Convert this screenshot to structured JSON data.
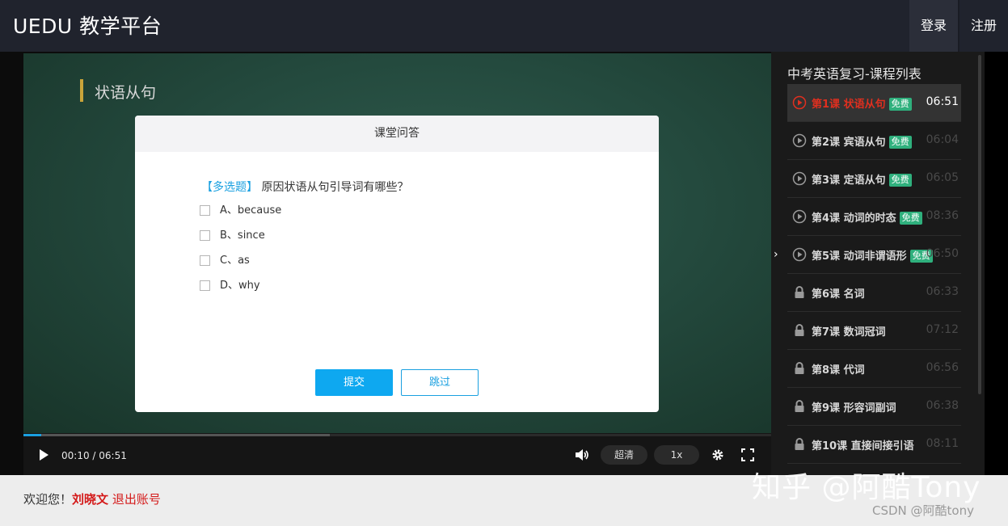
{
  "header": {
    "brand": "UEDU 教学平台",
    "login": "登录",
    "register": "注册"
  },
  "video": {
    "board_title": "状语从句",
    "current_time": "00:10 / 06:51",
    "quality": "超清",
    "speed": "1x",
    "progress_fraction": 0.024,
    "buffer_fraction": 0.41
  },
  "dialog": {
    "title": "课堂问答",
    "question_type": "【多选题】",
    "question": "原因状语从句引导词有哪些？",
    "options": [
      "A、because",
      "B、since",
      "C、as",
      "D、why"
    ],
    "submit": "提交",
    "skip": "跳过"
  },
  "sidebar": {
    "title": "中考英语复习-课程列表",
    "free_badge": "免费",
    "lessons": [
      {
        "name": "第1课 状语从句",
        "duration": "06:51",
        "free": true,
        "locked": false,
        "active": true
      },
      {
        "name": "第2课 宾语从句",
        "duration": "06:04",
        "free": true,
        "locked": false,
        "active": false
      },
      {
        "name": "第3课 定语从句",
        "duration": "06:05",
        "free": true,
        "locked": false,
        "active": false
      },
      {
        "name": "第4课 动词的时态",
        "duration": "08:36",
        "free": true,
        "locked": false,
        "active": false
      },
      {
        "name": "第5课 动词非谓语形",
        "duration": "06:50",
        "free": true,
        "locked": false,
        "active": false
      },
      {
        "name": "第6课 名词",
        "duration": "06:33",
        "free": false,
        "locked": true,
        "active": false
      },
      {
        "name": "第7课 数词冠词",
        "duration": "07:12",
        "free": false,
        "locked": true,
        "active": false
      },
      {
        "name": "第8课 代词",
        "duration": "06:56",
        "free": false,
        "locked": true,
        "active": false
      },
      {
        "name": "第9课 形容词副词",
        "duration": "06:38",
        "free": false,
        "locked": true,
        "active": false
      },
      {
        "name": "第10课 直接间接引语",
        "duration": "08:11",
        "free": false,
        "locked": true,
        "active": false
      }
    ]
  },
  "footer": {
    "welcome": "欢迎您！",
    "username": "刘晓文",
    "logout": "退出账号"
  },
  "watermark": {
    "main": "知乎 @阿酷Tony",
    "sub": "CSDN @阿酷tony"
  },
  "colors": {
    "accent_blue": "#0ea8f0",
    "active_red": "#e02f1f",
    "free_green": "#2fb07d"
  }
}
